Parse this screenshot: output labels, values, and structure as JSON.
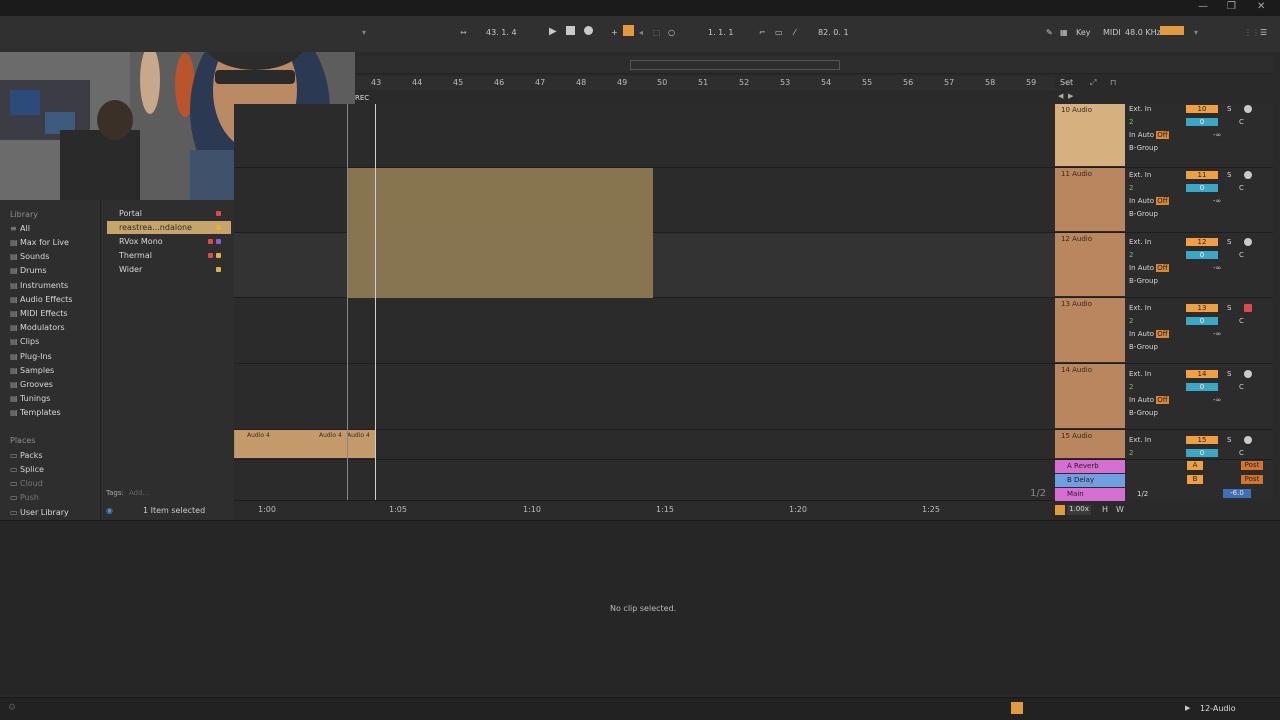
{
  "titlebar": {
    "min": "—",
    "max": "❐",
    "close": "✕"
  },
  "transport": {
    "position": "43. 1. 4",
    "loop_start": "1. 1. 1",
    "tempo_right": "82. 0. 1",
    "key": "Key",
    "midi": "MIDI",
    "sample_rate": "48.0 KHz"
  },
  "ruler": {
    "bars": [
      "43",
      "44",
      "45",
      "46",
      "47",
      "48",
      "49",
      "50",
      "51",
      "52",
      "53",
      "54",
      "55",
      "56",
      "57",
      "58",
      "59"
    ],
    "set_label": "Set",
    "rec_label": "REC"
  },
  "timeline": {
    "marks": [
      "1:00",
      "1:05",
      "1:10",
      "1:15",
      "1:20",
      "1:25"
    ]
  },
  "library": {
    "header": "Library",
    "items": [
      {
        "label": "All",
        "icon": "list-icon"
      },
      {
        "label": "Max for Live",
        "icon": "box-icon"
      },
      {
        "label": "Sounds",
        "icon": "box-icon"
      },
      {
        "label": "Drums",
        "icon": "box-icon"
      },
      {
        "label": "Instruments",
        "icon": "box-icon"
      },
      {
        "label": "Audio Effects",
        "icon": "box-icon"
      },
      {
        "label": "MIDI Effects",
        "icon": "box-icon"
      },
      {
        "label": "Modulators",
        "icon": "box-icon"
      },
      {
        "label": "Clips",
        "icon": "box-icon"
      },
      {
        "label": "Plug-Ins",
        "icon": "box-icon"
      },
      {
        "label": "Samples",
        "icon": "box-icon"
      },
      {
        "label": "Grooves",
        "icon": "box-icon"
      },
      {
        "label": "Tunings",
        "icon": "box-icon"
      },
      {
        "label": "Templates",
        "icon": "box-icon"
      }
    ],
    "places_header": "Places",
    "places": [
      {
        "label": "Packs"
      },
      {
        "label": "Splice"
      },
      {
        "label": "Cloud"
      },
      {
        "label": "Push"
      },
      {
        "label": "User Library"
      }
    ]
  },
  "browser": {
    "items": [
      {
        "label": "Portal",
        "dot": "#e04949"
      },
      {
        "label": "reastrea...ndalone",
        "dot": "#e0b040"
      },
      {
        "label": "RVox Mono",
        "dot": "#e04949",
        "dot2": "#8e5bd8"
      },
      {
        "label": "Thermal",
        "dot": "#e04949",
        "dot2": "#e0b040"
      },
      {
        "label": "Wider",
        "dot": "#e0b040"
      }
    ],
    "tags_label": "Tags:",
    "tags_add": "Add...",
    "selected_text": "1 Item selected"
  },
  "tracks": [
    {
      "name": "10 Audio",
      "in": "Ext. In",
      "ch": "2",
      "num": "10",
      "group": "B-Group"
    },
    {
      "name": "11 Audio",
      "in": "Ext. In",
      "ch": "2",
      "num": "11",
      "group": "B-Group"
    },
    {
      "name": "12 Audio",
      "in": "Ext. In",
      "ch": "2",
      "num": "12",
      "group": "B-Group"
    },
    {
      "name": "13 Audio",
      "in": "Ext. In",
      "ch": "2",
      "num": "13",
      "group": "B-Group"
    },
    {
      "name": "14 Audio",
      "in": "Ext. In",
      "ch": "2",
      "num": "14",
      "group": "B-Group"
    },
    {
      "name": "15 Audio",
      "in": "Ext. In",
      "ch": "2",
      "num": "15",
      "group": ""
    }
  ],
  "track_controls": {
    "in": "In",
    "auto": "Auto",
    "off": "Off",
    "zero": "0",
    "c": "C",
    "inf": "-∞",
    "s": "S"
  },
  "returns": [
    {
      "label": "A Reverb",
      "color": "#d76fd2",
      "tag": "A",
      "post": "Post"
    },
    {
      "label": "B Delay",
      "color": "#6f9fe0",
      "tag": "B",
      "post": "Post"
    },
    {
      "label": "Main",
      "color": "#d76fd2",
      "tag": "1/2",
      "vol": "-6.0"
    }
  ],
  "arrangement": {
    "clip1": "Audio 4",
    "clip2": "Audio 4",
    "clip3": "Audio 4"
  },
  "page_indicator": "1/2",
  "zoom": "1.00x",
  "hw": {
    "h": "H",
    "w": "W"
  },
  "detail": {
    "message": "No clip selected."
  },
  "status": {
    "track": "12-Audio"
  }
}
